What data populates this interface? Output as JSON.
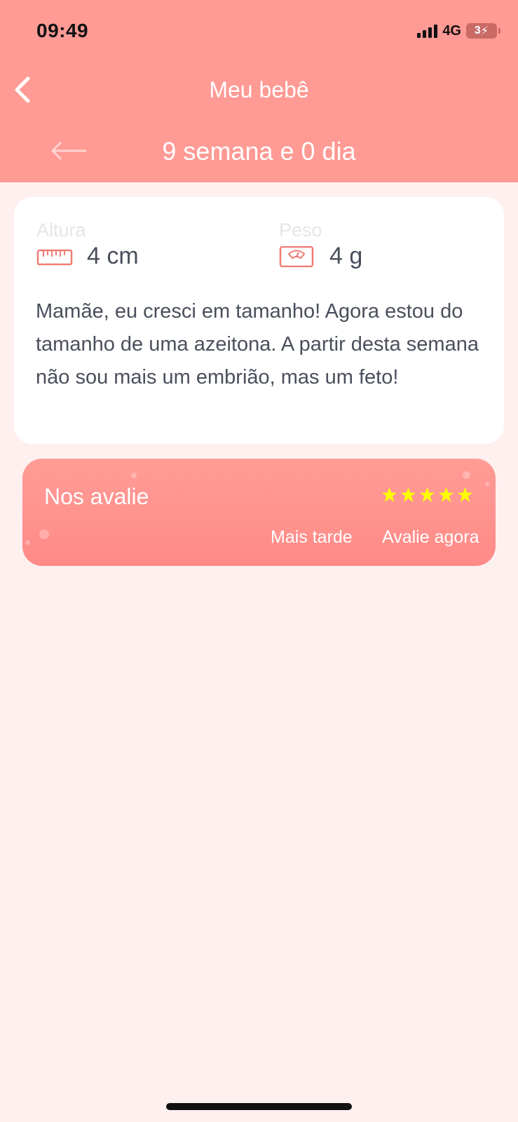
{
  "status_bar": {
    "time": "09:49",
    "network": "4G",
    "battery": "3"
  },
  "nav": {
    "title": "Meu bebê",
    "back_icon": "chevron-left-icon"
  },
  "week": {
    "label": "9 semana e 0 dia",
    "prev_icon": "arrow-left-icon"
  },
  "metrics": {
    "height": {
      "label": "Altura",
      "value": "4 cm",
      "icon": "ruler-icon"
    },
    "weight": {
      "label": "Peso",
      "value": "4 g",
      "icon": "scale-icon"
    }
  },
  "description": "Mamãe, eu cresci em tamanho! Agora estou do tamanho de uma azeitona. A partir desta semana não sou mais um embrião, mas um feto!",
  "rating": {
    "title": "Nos avalie",
    "stars": 5,
    "later_label": "Mais tarde",
    "rate_label": "Avalie agora"
  },
  "colors": {
    "header": "#ff9a94",
    "background": "#fff0f0",
    "card_text": "#4a4f5c",
    "star": "#ffff00",
    "accent_icon": "#f07c76"
  }
}
